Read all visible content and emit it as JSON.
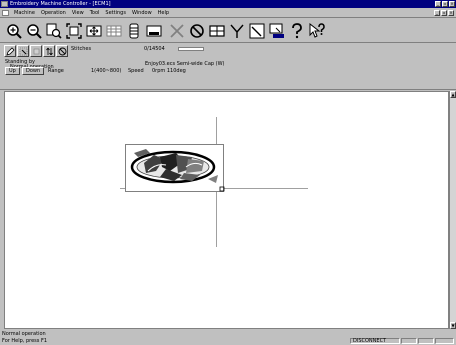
{
  "window": {
    "title": "Embroidery Machine Controller - [ECM1]"
  },
  "menu": [
    {
      "label": "Machine"
    },
    {
      "label": "Operation"
    },
    {
      "label": "View"
    },
    {
      "label": "Tool"
    },
    {
      "label": "Settings"
    },
    {
      "label": "Window"
    },
    {
      "label": "Help"
    }
  ],
  "toolbar": {
    "icons": [
      "zoom-in-icon",
      "zoom-out-icon",
      "zoom-window-icon",
      "fit-all-icon",
      "pan-icon",
      "grid-icon",
      "machine-icon",
      "monitor-icon",
      "cancel-icon",
      "stop-icon",
      "frame-icon",
      "hoop-icon",
      "trace-icon",
      "transfer-icon",
      "help-icon",
      "context-help-icon"
    ]
  },
  "subbar": {
    "stitches_label": "Stitches",
    "stitches_value": "0/14504",
    "progress_fraction": 0.0,
    "status_label": "Standing by",
    "operation_label": "Normal operation",
    "file_info": "Enjoy03.ecs  Semi-wide Cap (W)",
    "up_button": "Up",
    "down_button": "Down",
    "range_label": "Range",
    "range_value": "1(400~800)",
    "speed_label": "Speed",
    "speed_value": "0rpm  110deg"
  },
  "design": {
    "logo_text": "Enjoy"
  },
  "status": {
    "line1": "Normal operation",
    "line2": "For Help, press F1",
    "connection": "DISCONNECT"
  },
  "colors": {
    "titlebar": "#000080",
    "face": "#c0c0c0"
  }
}
